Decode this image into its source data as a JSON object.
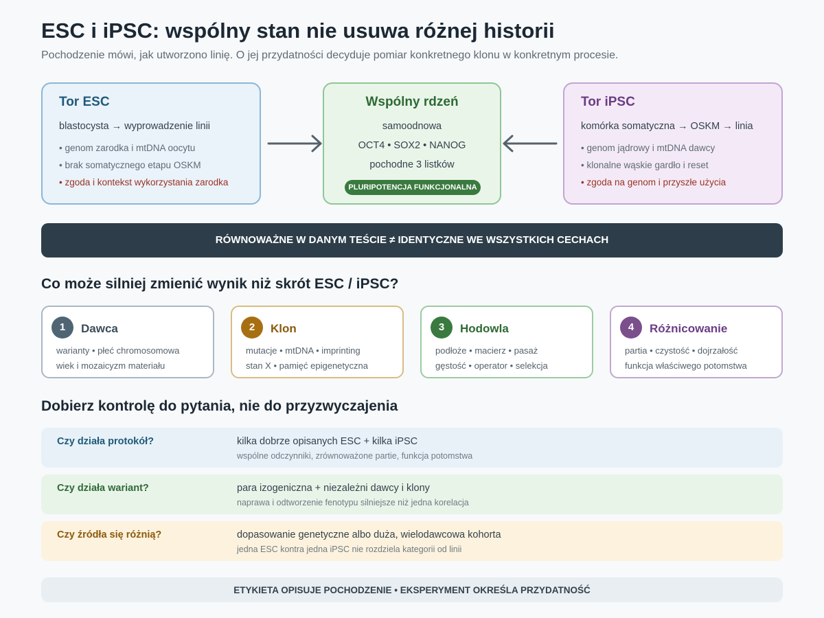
{
  "header": {
    "title": "ESC i iPSC: wspólny stan nie usuwa różnej historii",
    "subtitle": "Pochodzenie mówi, jak utworzono linię. O jej przydatności decyduje pomiar konkretnego klonu w konkretnym procesie."
  },
  "esc": {
    "title": "Tor ESC",
    "lead": "blastocysta → wyprowadzenie linii",
    "items": [
      "• genom zarodka i mtDNA oocytu",
      "• brak somatycznego etapu OSKM",
      "• zgoda i kontekst wykorzystania zarodka"
    ]
  },
  "core": {
    "title": "Wspólny rdzeń",
    "lines": [
      "samoodnowa",
      "OCT4 • SOX2 • NANOG",
      "pochodne 3 listków"
    ],
    "pill": "PLURIPOTENCJA FUNKCJONALNA"
  },
  "ipsc": {
    "title": "Tor iPSC",
    "lead": "komórka somatyczna → OSKM → linia",
    "items": [
      "• genom jądrowy i mtDNA dawcy",
      "• klonalne wąskie gardło i reset",
      "• zgoda na genom i przyszłe użycia"
    ]
  },
  "banner": "RÓWNOWAŻNE W DANYM TEŚCIE ≠ IDENTYCZNE WE WSZYSTKICH CECHACH",
  "factors_section": {
    "title": "Co może silniej zmienić wynik niż skrót ESC / iPSC?",
    "items": [
      {
        "num": "1",
        "title": "Dawca",
        "line1": "warianty • płeć chromosomowa",
        "line2": "wiek i mozaicyzm materiału"
      },
      {
        "num": "2",
        "title": "Klon",
        "line1": "mutacje • mtDNA • imprinting",
        "line2": "stan X • pamięć epigenetyczna"
      },
      {
        "num": "3",
        "title": "Hodowla",
        "line1": "podłoże • macierz • pasaż",
        "line2": "gęstość • operator • selekcja"
      },
      {
        "num": "4",
        "title": "Różnicowanie",
        "line1": "partia • czystość • dojrzałość",
        "line2": "funkcja właściwego potomstwa"
      }
    ]
  },
  "controls_section": {
    "title": "Dobierz kontrolę do pytania, nie do przyzwyczajenia",
    "rows": [
      {
        "q": "Czy działa protokół?",
        "a": "kilka dobrze opisanych ESC + kilka iPSC",
        "note": "wspólne odczynniki, zrównoważone partie, funkcja potomstwa"
      },
      {
        "q": "Czy działa wariant?",
        "a": "para izogeniczna + niezależni dawcy i klony",
        "note": "naprawa i odtworzenie fenotypu silniejsze niż jedna korelacja"
      },
      {
        "q": "Czy źródła się różnią?",
        "a": "dopasowanie genetyczne albo duża, wielodawcowa kohorta",
        "note": "jedna ESC kontra jedna iPSC nie rozdziela kategorii od linii"
      }
    ]
  },
  "footer": "ETYKIETA OPISUJE POCHODZENIE • EKSPERYMENT OKREŚLA PRZYDATNOŚĆ",
  "colors": {
    "esc": "#1f5a7a",
    "core": "#2e6a35",
    "ipsc": "#6a3d84",
    "banner": "#2d3e4a",
    "factor_donor": "#4f6573",
    "factor_clone": "#a86f12",
    "factor_culture": "#3a7a3f",
    "factor_diff": "#7a4f8c"
  },
  "icons": {
    "arrow_left_to_core": "arrow-right-icon",
    "arrow_right_to_core": "arrow-left-icon"
  }
}
